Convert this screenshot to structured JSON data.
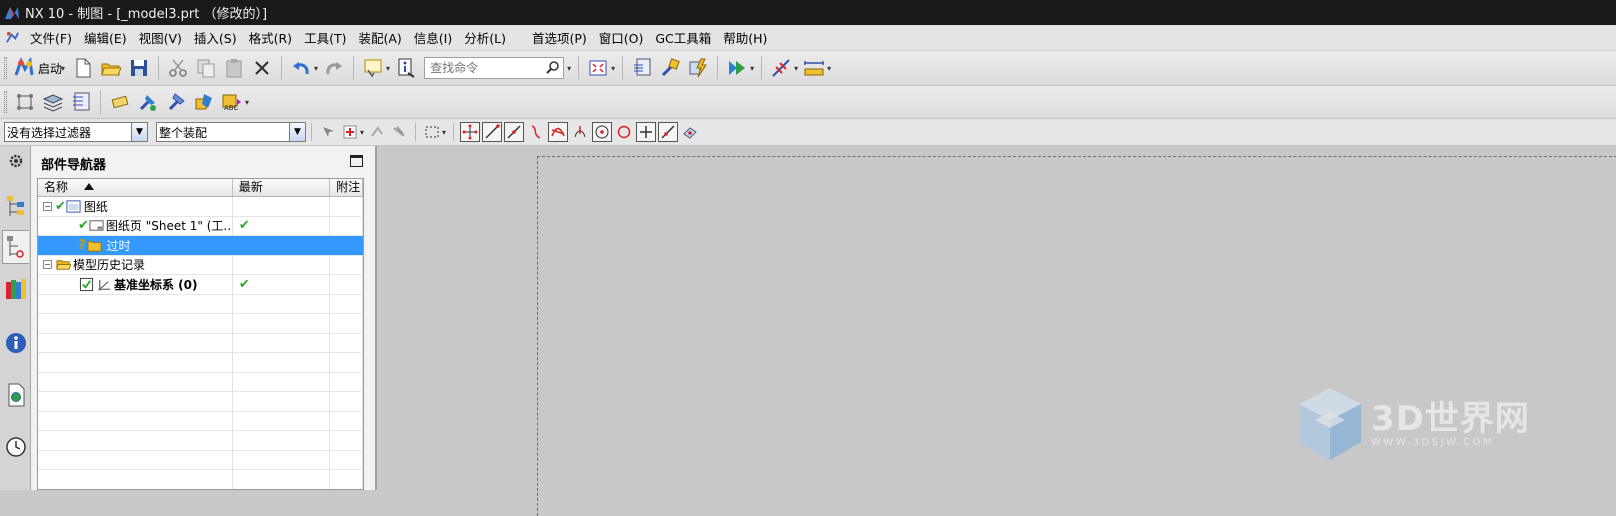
{
  "window": {
    "title": "NX 10 - 制图 - [_model3.prt （修改的）]"
  },
  "menu": [
    "文件(F)",
    "编辑(E)",
    "视图(V)",
    "插入(S)",
    "格式(R)",
    "工具(T)",
    "装配(A)",
    "信息(I)",
    "分析(L)",
    "首选项(P)",
    "窗口(O)",
    "GC工具箱",
    "帮助(H)"
  ],
  "toolbar": {
    "start_label": "启动",
    "search_placeholder": "查找命令"
  },
  "selection_bar": {
    "filter_value": "没有选择过滤器",
    "scope_value": "整个装配"
  },
  "navigator": {
    "title": "部件导航器",
    "columns": [
      "名称",
      "最新",
      "附注"
    ],
    "rows": [
      {
        "name": "图纸",
        "latest": ""
      },
      {
        "name": "图纸页 \"Sheet 1\" (工...",
        "latest": "✔"
      },
      {
        "name": "过时",
        "latest": ""
      },
      {
        "name": "模型历史记录",
        "latest": ""
      },
      {
        "name": "基准坐标系 (0)",
        "latest": "✔"
      }
    ]
  },
  "watermark": {
    "brand": "3D世界网",
    "url": "WWW.3DSJW.COM"
  },
  "colors": {
    "selection": "#3399ff",
    "title_bar": "#1a1a1a",
    "check": "#29a829"
  }
}
